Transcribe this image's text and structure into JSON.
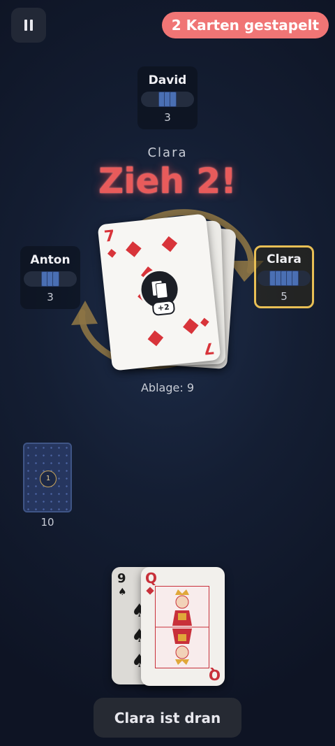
{
  "top_bar": {
    "pause_icon": "pause-icon",
    "stack_badge": "2 Karten gestapelt"
  },
  "opponents": {
    "top": {
      "name": "David",
      "count": "3"
    },
    "left": {
      "name": "Anton",
      "count": "3"
    },
    "right": {
      "name": "Clara",
      "count": "5",
      "active": true
    }
  },
  "callout": {
    "player": "Clara",
    "shout": "Zieh 2!"
  },
  "discard": {
    "top_card": {
      "rank": "7",
      "suit": "diamonds",
      "action": "+2"
    },
    "label": "Ablage: 9"
  },
  "draw_pile": {
    "badge": "1",
    "count": "10"
  },
  "hand": [
    {
      "rank": "9",
      "suit": "spades"
    },
    {
      "rank": "Q",
      "suit": "diamonds"
    }
  ],
  "turn_banner": "Clara ist dran",
  "colors": {
    "accent_active": "#e8bf55",
    "badge": "#f07575",
    "shout": "#e85b5b",
    "card_back": "#26365f"
  }
}
